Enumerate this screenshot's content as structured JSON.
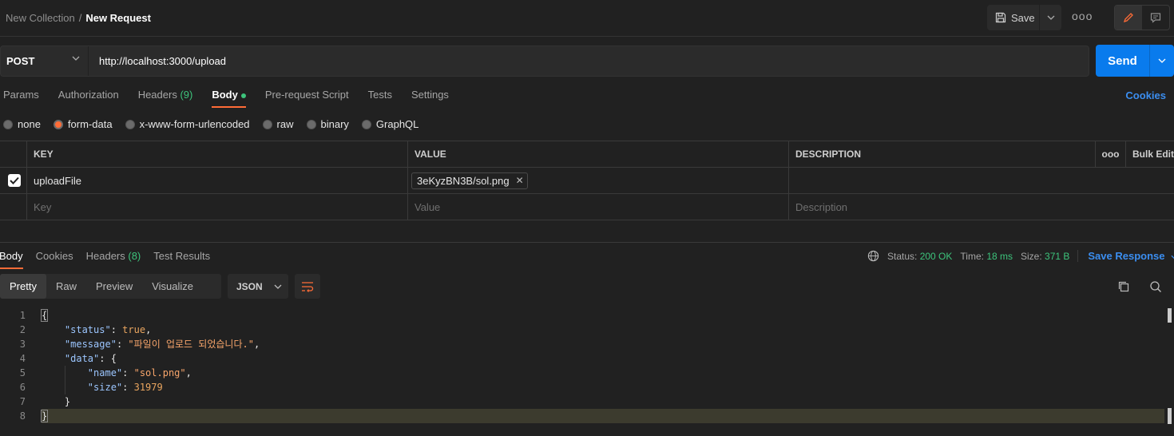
{
  "header": {
    "collection": "New Collection",
    "separator": "/",
    "request_name": "New Request",
    "save_label": "Save",
    "more_label": "ooo"
  },
  "request": {
    "method": "POST",
    "url": "http://localhost:3000/upload",
    "send_label": "Send"
  },
  "request_tabs": [
    {
      "label": "Params"
    },
    {
      "label": "Authorization"
    },
    {
      "label": "Headers",
      "count": "(9)"
    },
    {
      "label": "Body"
    },
    {
      "label": "Pre-request Script"
    },
    {
      "label": "Tests"
    },
    {
      "label": "Settings"
    }
  ],
  "cookies_link": "Cookies",
  "body_types": [
    "none",
    "form-data",
    "x-www-form-urlencoded",
    "raw",
    "binary",
    "GraphQL"
  ],
  "body_type_selected": "form-data",
  "form_table": {
    "headers": {
      "key": "KEY",
      "value": "VALUE",
      "description": "DESCRIPTION",
      "more": "ooo",
      "bulk": "Bulk Edit"
    },
    "rows": [
      {
        "key": "uploadFile",
        "value": "3eKyzBN3B/sol.png",
        "checked": true
      }
    ],
    "placeholders": {
      "key": "Key",
      "value": "Value",
      "description": "Description"
    }
  },
  "response": {
    "tabs": [
      {
        "label": "Body"
      },
      {
        "label": "Cookies"
      },
      {
        "label": "Headers",
        "count": "(8)"
      },
      {
        "label": "Test Results"
      }
    ],
    "status_label": "Status:",
    "status_value": "200 OK",
    "time_label": "Time:",
    "time_value": "18 ms",
    "size_label": "Size:",
    "size_value": "371 B",
    "save_response": "Save Response",
    "views": [
      "Pretty",
      "Raw",
      "Preview",
      "Visualize"
    ],
    "format": "JSON"
  },
  "code": {
    "line_numbers": [
      "1",
      "2",
      "3",
      "4",
      "5",
      "6",
      "7",
      "8"
    ],
    "l1": "{",
    "status_key": "\"status\"",
    "status_val": "true",
    "message_key": "\"message\"",
    "message_val": "\"파일이 업로드 되었습니다.\"",
    "data_key": "\"data\"",
    "data_open": "{",
    "name_key": "\"name\"",
    "name_val": "\"sol.png\"",
    "size_key": "\"size\"",
    "size_val": "31979",
    "data_close": "}",
    "l8": "}"
  },
  "colors": {
    "accent": "#ff6c37",
    "send": "#097bed",
    "link": "#3b8ef0",
    "ok": "#3dc47c"
  }
}
